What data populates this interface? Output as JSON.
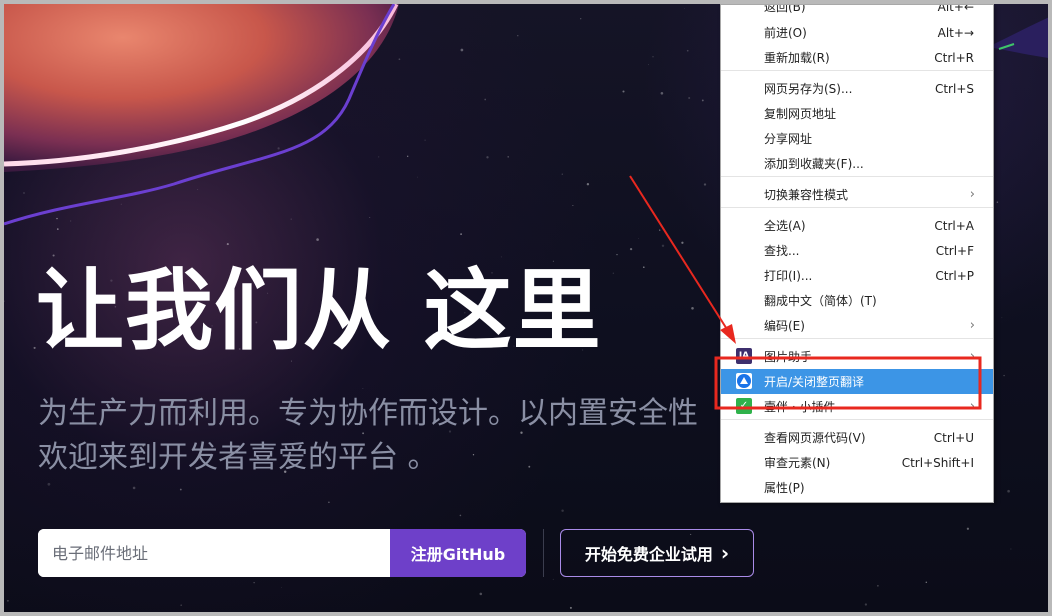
{
  "hero": {
    "headline": "让我们从 这里",
    "subtitle_line1": "为生产力而利用。专为协作而设计。以内置安全性",
    "subtitle_line2": "欢迎来到开发者喜爱的平台 。",
    "email_placeholder": "电子邮件地址",
    "signup_label": "注册GitHub",
    "trial_label": "开始免费企业试用",
    "trial_chevron": "›"
  },
  "context_menu": {
    "items": [
      {
        "label": "返回(B)",
        "shortcut": "Alt+←"
      },
      {
        "label": "前进(O)",
        "shortcut": "Alt+→"
      },
      {
        "label": "重新加载(R)",
        "shortcut": "Ctrl+R"
      },
      {
        "label": "网页另存为(S)...",
        "shortcut": "Ctrl+S"
      },
      {
        "label": "复制网页地址",
        "shortcut": ""
      },
      {
        "label": "分享网址",
        "shortcut": ""
      },
      {
        "label": "添加到收藏夹(F)...",
        "shortcut": ""
      },
      {
        "label": "切换兼容性模式",
        "shortcut": "",
        "submenu": true
      },
      {
        "label": "全选(A)",
        "shortcut": "Ctrl+A"
      },
      {
        "label": "查找...",
        "shortcut": "Ctrl+F"
      },
      {
        "label": "打印(I)...",
        "shortcut": "Ctrl+P"
      },
      {
        "label": "翻成中文（简体）(T)",
        "shortcut": ""
      },
      {
        "label": "编码(E)",
        "shortcut": "",
        "submenu": true
      },
      {
        "label": "图片助手",
        "shortcut": "",
        "submenu": true,
        "icon": "ia-icon",
        "icon_text": "IA"
      },
      {
        "label": "开启/关闭整页翻译",
        "shortcut": "",
        "highlighted": true,
        "icon": "translate-icon"
      },
      {
        "label": "壹伴 · 小插件",
        "shortcut": "",
        "submenu": true,
        "icon": "plugin-icon",
        "icon_text": "✓"
      },
      {
        "label": "查看网页源代码(V)",
        "shortcut": "Ctrl+U"
      },
      {
        "label": "审查元素(N)",
        "shortcut": "Ctrl+Shift+I"
      },
      {
        "label": "属性(P)",
        "shortcut": ""
      }
    ],
    "submenu_arrow": "›"
  },
  "colors": {
    "accent_purple": "#6e40c9",
    "highlight_blue": "#3c95e6",
    "annotation_red": "#e8281f"
  }
}
